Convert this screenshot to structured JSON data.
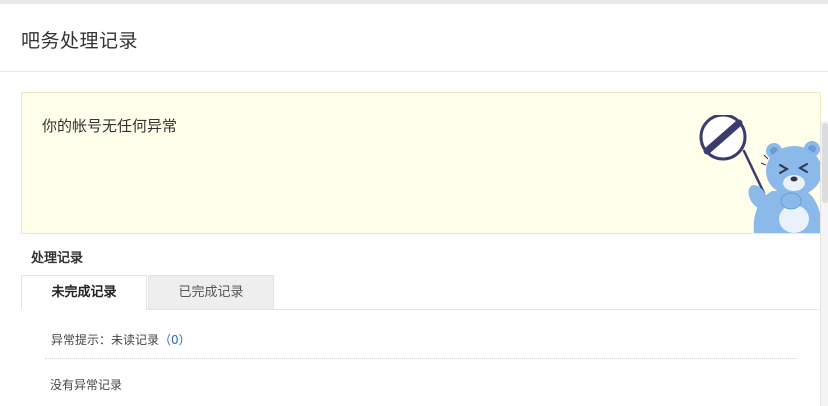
{
  "page": {
    "title": "吧务处理记录"
  },
  "notice": {
    "text": "你的帐号无任何异常",
    "mascot_icon": "bear-holding-no-sign-icon",
    "colors": {
      "background": "#fffeea",
      "bear": "#8ab9ea",
      "sign": "#3b3c6e"
    }
  },
  "records": {
    "section_title": "处理记录",
    "tabs": [
      {
        "label": "未完成记录",
        "active": true
      },
      {
        "label": "已完成记录",
        "active": false
      }
    ],
    "alert_prefix": "异常提示：未读记录",
    "unread_count": "（0）",
    "empty_text": "没有异常记录"
  },
  "colors": {
    "link": "#2a6db5",
    "tab_inactive_bg": "#eeeeee"
  }
}
